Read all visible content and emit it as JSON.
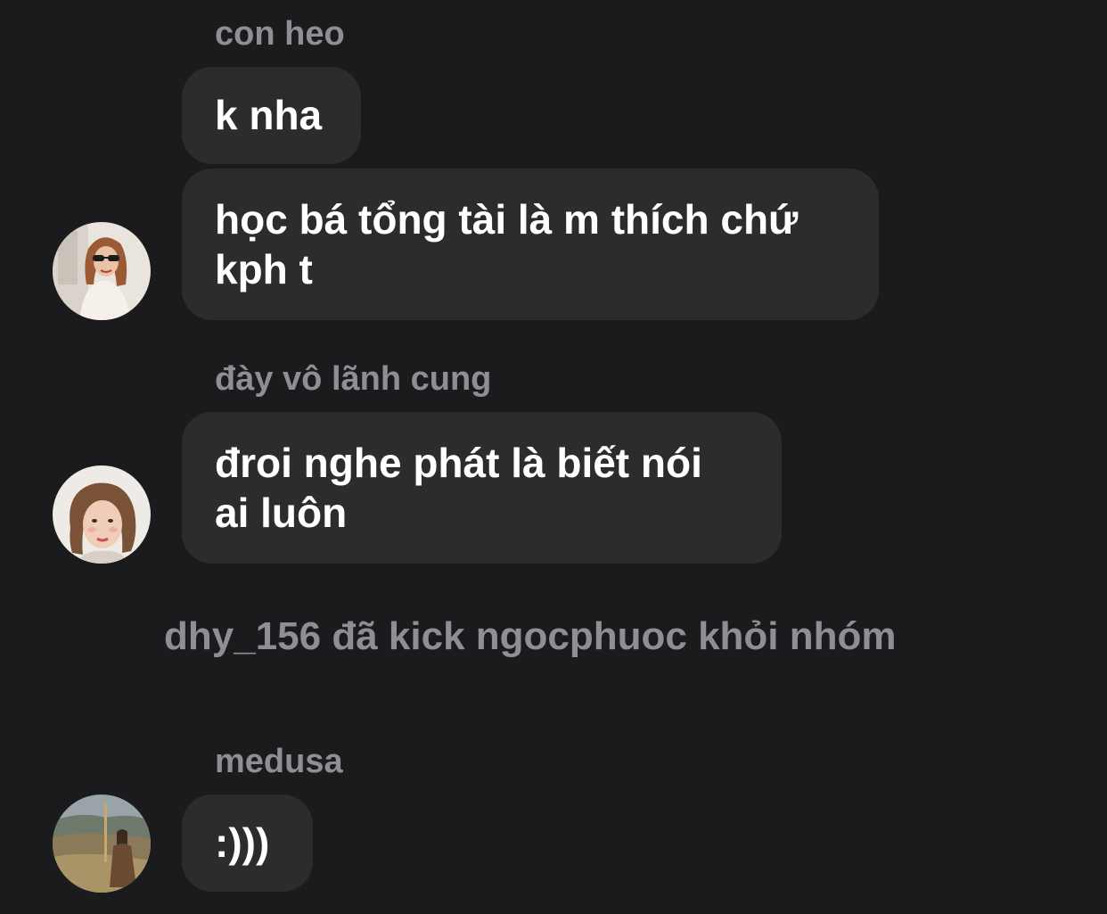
{
  "messages": [
    {
      "sender": "con heo",
      "bubbles": [
        {
          "lines": [
            "k nha"
          ]
        },
        {
          "lines": [
            "học bá tổng tài là m thích chứ",
            "kph t"
          ]
        }
      ]
    },
    {
      "sender": "đày vô lãnh cung",
      "bubbles": [
        {
          "lines": [
            "đroi nghe phát là biết nói",
            "ai luôn"
          ]
        }
      ]
    }
  ],
  "system_notice": "dhy_156 đã kick ngocphuoc khỏi nhóm",
  "last_message": {
    "sender": "medusa",
    "bubbles": [
      {
        "lines": [
          ":)))"
        ]
      }
    ]
  },
  "colors": {
    "background": "#1b1b1d",
    "bubble": "#2c2c2e",
    "text": "#ffffff",
    "muted": "#8e8e93"
  }
}
